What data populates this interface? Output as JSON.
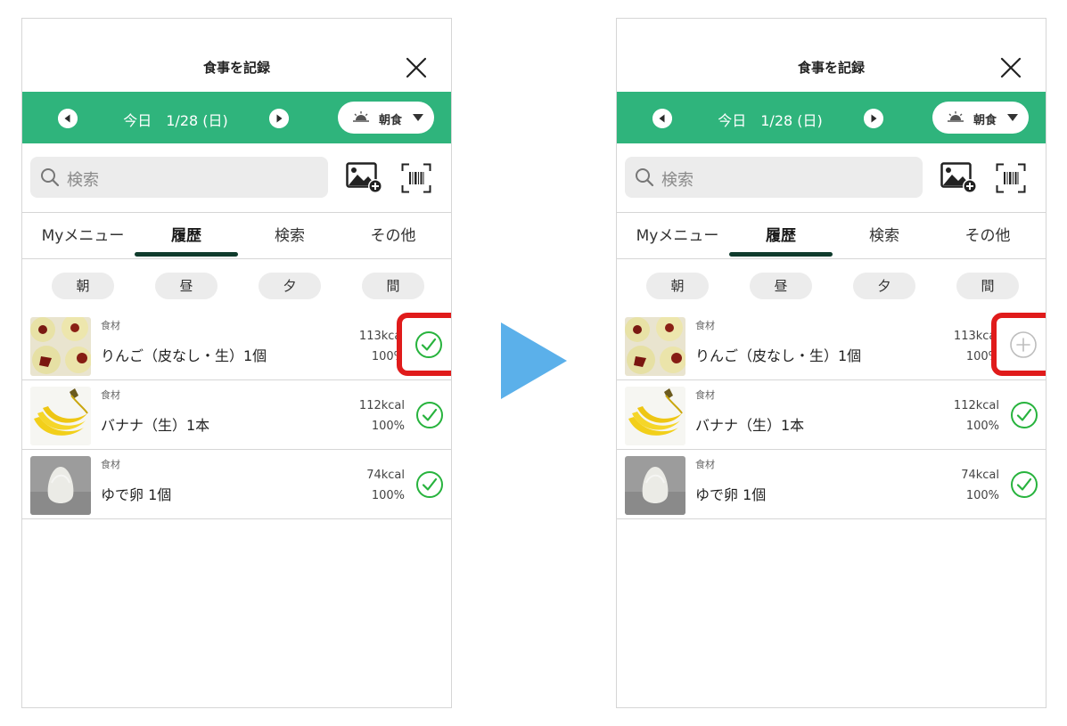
{
  "colors": {
    "accent_green": "#2fb47c",
    "check_green": "#27b33d",
    "highlight_red": "#e01b1b",
    "arrow_blue": "#5bb0ea",
    "add_grey": "#bdbdbd"
  },
  "arrow_icon": "right-triangle-arrow",
  "screens": [
    {
      "header": {
        "title": "食事を記録",
        "close_icon": "close-icon"
      },
      "datebar": {
        "prev_icon": "prev-icon",
        "today": "今日",
        "date": "1/28 (日)",
        "next_icon": "next-icon",
        "meal_label": "朝食",
        "meal_icon": "sunrise-icon",
        "caret_icon": "caret-down-icon"
      },
      "search": {
        "placeholder": "検索",
        "photo_icon": "photo-add-icon",
        "barcode_icon": "barcode-scan-icon"
      },
      "tabs": [
        {
          "label": "Myメニュー"
        },
        {
          "label": "履歴",
          "active": true
        },
        {
          "label": "検索"
        },
        {
          "label": "その他"
        }
      ],
      "meal_chips": [
        "朝",
        "昼",
        "夕",
        "間"
      ],
      "items": [
        {
          "category": "食材",
          "name": "りんご（皮なし・生）1個",
          "kcal": "113kcal",
          "percent": "100%",
          "status": "checked",
          "status_icon": "check-circle-icon",
          "image": "apple-slices"
        },
        {
          "category": "食材",
          "name": "バナナ（生）1本",
          "kcal": "112kcal",
          "percent": "100%",
          "status": "checked",
          "status_icon": "check-circle-icon",
          "image": "banana-bunch"
        },
        {
          "category": "食材",
          "name": "ゆで卵 1個",
          "kcal": "74kcal",
          "percent": "100%",
          "status": "checked",
          "status_icon": "check-circle-icon",
          "image": "boiled-egg"
        }
      ]
    },
    {
      "header": {
        "title": "食事を記録",
        "close_icon": "close-icon"
      },
      "datebar": {
        "prev_icon": "prev-icon",
        "today": "今日",
        "date": "1/28 (日)",
        "next_icon": "next-icon",
        "meal_label": "朝食",
        "meal_icon": "sunrise-icon",
        "caret_icon": "caret-down-icon"
      },
      "search": {
        "placeholder": "検索",
        "photo_icon": "photo-add-icon",
        "barcode_icon": "barcode-scan-icon"
      },
      "tabs": [
        {
          "label": "Myメニュー"
        },
        {
          "label": "履歴",
          "active": true
        },
        {
          "label": "検索"
        },
        {
          "label": "その他"
        }
      ],
      "meal_chips": [
        "朝",
        "昼",
        "夕",
        "間"
      ],
      "items": [
        {
          "category": "食材",
          "name": "りんご（皮なし・生）1個",
          "kcal": "113kcal",
          "percent": "100%",
          "status": "unchecked",
          "status_icon": "add-circle-icon",
          "image": "apple-slices"
        },
        {
          "category": "食材",
          "name": "バナナ（生）1本",
          "kcal": "112kcal",
          "percent": "100%",
          "status": "checked",
          "status_icon": "check-circle-icon",
          "image": "banana-bunch"
        },
        {
          "category": "食材",
          "name": "ゆで卵 1個",
          "kcal": "74kcal",
          "percent": "100%",
          "status": "checked",
          "status_icon": "check-circle-icon",
          "image": "boiled-egg"
        }
      ]
    }
  ]
}
